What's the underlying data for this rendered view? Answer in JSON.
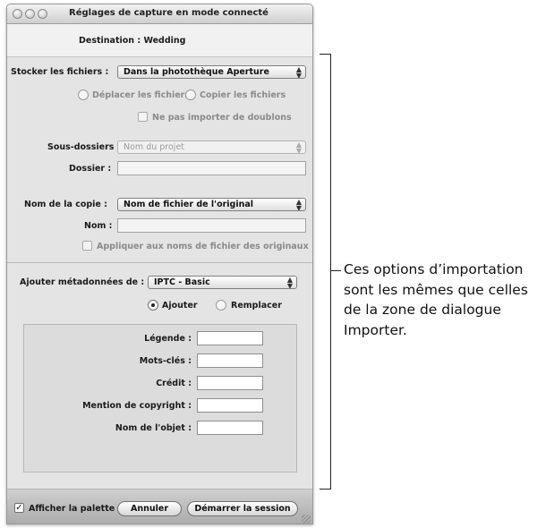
{
  "window": {
    "title": "Réglages de capture en mode connecté"
  },
  "destination": {
    "text": "Destination : Wedding"
  },
  "storage": {
    "label": "Stocker les fichiers :",
    "value": "Dans la photothèque Aperture",
    "move_label": "Déplacer les fichiers",
    "copy_label": "Copier les fichiers",
    "no_duplicates_label": "Ne pas importer de doublons"
  },
  "subfolders": {
    "label": "Sous-dossiers :",
    "value": "Nom du projet",
    "folder_label": "Dossier :",
    "folder_value": ""
  },
  "version_name": {
    "label": "Nom de la copie :",
    "value": "Nom de fichier de l'original",
    "name_label": "Nom :",
    "name_value": "",
    "apply_label": "Appliquer aux noms de fichier des originaux"
  },
  "metadata": {
    "label": "Ajouter métadonnées de :",
    "value": "IPTC - Basic",
    "add_label": "Ajouter",
    "replace_label": "Remplacer",
    "fields": [
      {
        "label": "Légende :",
        "value": ""
      },
      {
        "label": "Mots-clés :",
        "value": ""
      },
      {
        "label": "Crédit :",
        "value": ""
      },
      {
        "label": "Mention de copyright :",
        "value": ""
      },
      {
        "label": "Nom de l'objet :",
        "value": ""
      }
    ]
  },
  "footer": {
    "show_palette_label": "Afficher la palette",
    "cancel_label": "Annuler",
    "start_label": "Démarrer la session"
  },
  "callout": {
    "text": "Ces options d’importation sont les mêmes que celles de la zone de dialogue Importer."
  }
}
